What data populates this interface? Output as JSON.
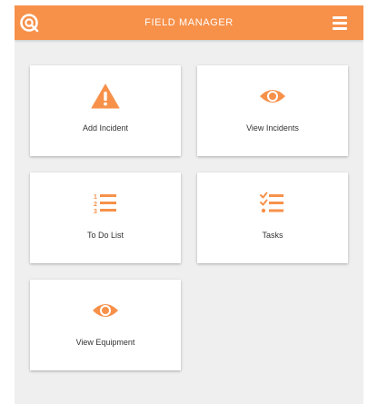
{
  "header": {
    "title": "FIELD MANAGER",
    "logo_icon": "app-logo-icon",
    "menu_icon": "hamburger-menu-icon",
    "accent_color": "#f7914a"
  },
  "tiles": [
    {
      "label": "Add Incident",
      "icon": "warning-icon"
    },
    {
      "label": "View Incidents",
      "icon": "eye-icon"
    },
    {
      "label": "To Do List",
      "icon": "numbered-list-icon"
    },
    {
      "label": "Tasks",
      "icon": "checklist-icon"
    },
    {
      "label": "View Equipment",
      "icon": "eye-icon"
    }
  ]
}
